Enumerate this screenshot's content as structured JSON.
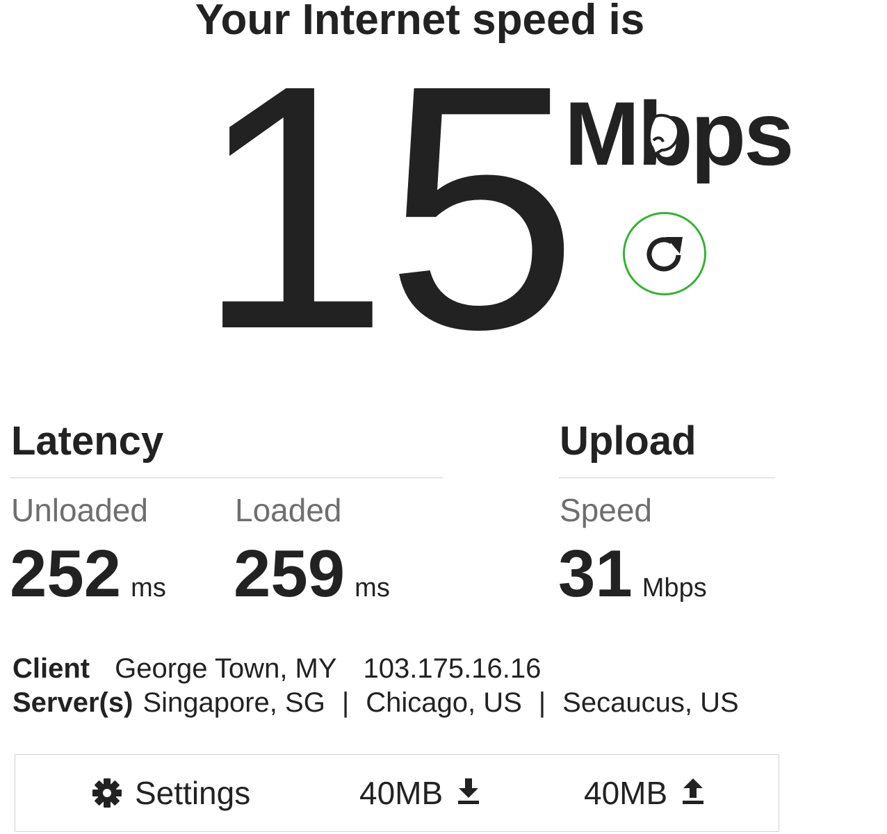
{
  "headline": "Your Internet speed is",
  "speed": {
    "value": "15",
    "units": "Mbps"
  },
  "latency": {
    "title": "Latency",
    "unloaded": {
      "label": "Unloaded",
      "value": "252",
      "unit": "ms"
    },
    "loaded": {
      "label": "Loaded",
      "value": "259",
      "unit": "ms"
    }
  },
  "upload": {
    "title": "Upload",
    "speed": {
      "label": "Speed",
      "value": "31",
      "unit": "Mbps"
    }
  },
  "client": {
    "label": "Client",
    "location": "George Town, MY",
    "ip": "103.175.16.16"
  },
  "servers": {
    "label": "Server(s)",
    "list": [
      "Singapore, SG",
      "Chicago, US",
      "Secaucus, US"
    ],
    "separator": "|"
  },
  "settings_bar": {
    "settings_label": "Settings",
    "download_size": "40MB",
    "upload_size": "40MB"
  },
  "icons": {
    "refresh": "refresh-icon",
    "settings": "gear-icon",
    "download": "download-arrow-icon",
    "upload": "upload-arrow-icon"
  },
  "colors": {
    "text": "#222222",
    "muted": "#6e6e6e",
    "accent": "#2fb52f",
    "border": "#d0d0d0"
  }
}
